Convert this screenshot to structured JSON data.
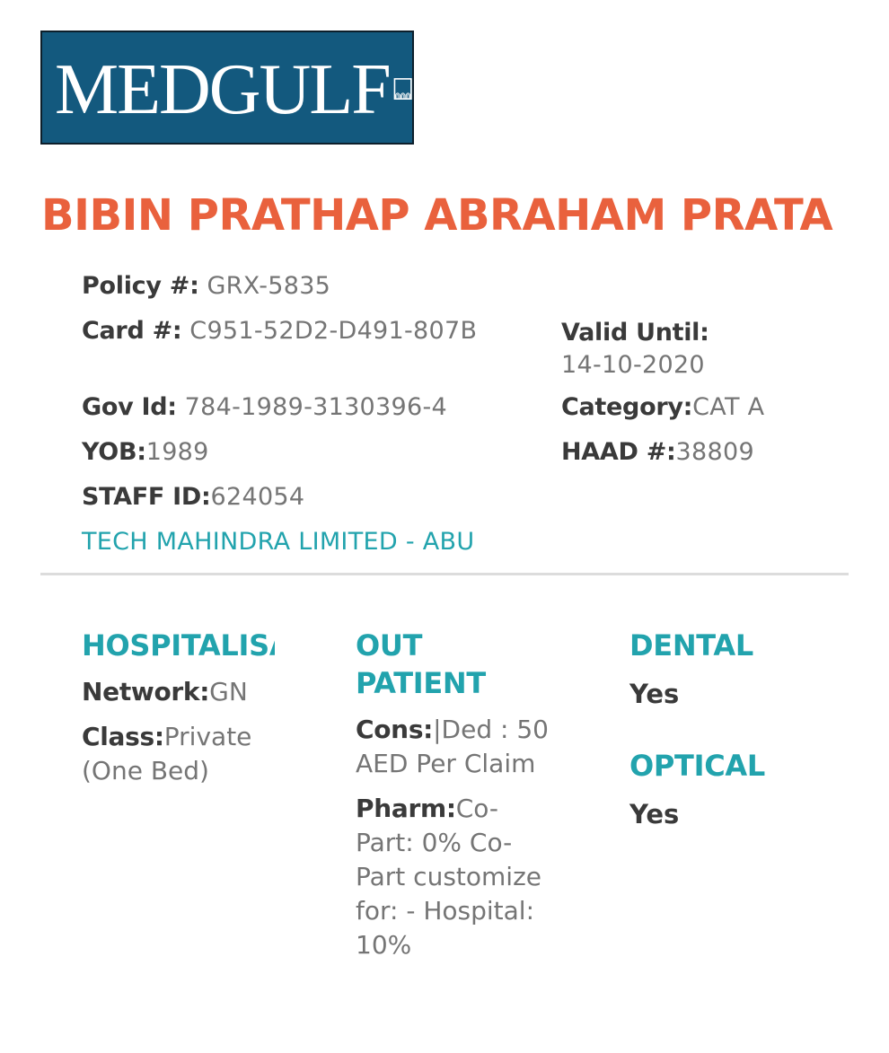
{
  "brand": {
    "logo_text": "MEDGULF",
    "logo_color": "#13597e",
    "logo_mark_icon": "arches-icon"
  },
  "member": {
    "name": "BIBIN PRATHAP ABRAHAM PRATA",
    "name_color": "#e9613d"
  },
  "details": {
    "policy": {
      "label": "Policy #:",
      "value": " GRX-5835"
    },
    "card": {
      "label": "Card #:",
      "value": " C951-52D2-D491-807B"
    },
    "valid_until": {
      "label": "Valid Until:",
      "value": "14-10-2020"
    },
    "gov_id": {
      "label": "Gov Id:",
      "value": " 784-1989-3130396-4"
    },
    "category": {
      "label": "Category:",
      "value": "CAT A"
    },
    "yob": {
      "label": "YOB:",
      "value": "1989"
    },
    "haad": {
      "label": "HAAD #:",
      "value": "38809"
    },
    "staff_id": {
      "label": "STAFF ID:",
      "value": "624054"
    },
    "employer": "TECH MAHINDRA LIMITED - ABU",
    "accent_color": "#22a3ad"
  },
  "benefits": {
    "hospitalisation": {
      "title": "HOSPITALISA",
      "network": {
        "label": "Network:",
        "value": "GN"
      },
      "class": {
        "label": "Class:",
        "value": "Private (One Bed)"
      }
    },
    "outpatient": {
      "title": "OUT PATIENT",
      "cons": {
        "label": "Cons:",
        "value": "|Ded : 50 AED Per Claim"
      },
      "pharm": {
        "label": "Pharm:",
        "value": "Co-Part: 0% Co-Part customize for: - Hospital: 10%"
      }
    },
    "dental": {
      "title": "DENTAL",
      "value": "Yes"
    },
    "optical": {
      "title": "OPTICAL",
      "value": "Yes"
    }
  }
}
